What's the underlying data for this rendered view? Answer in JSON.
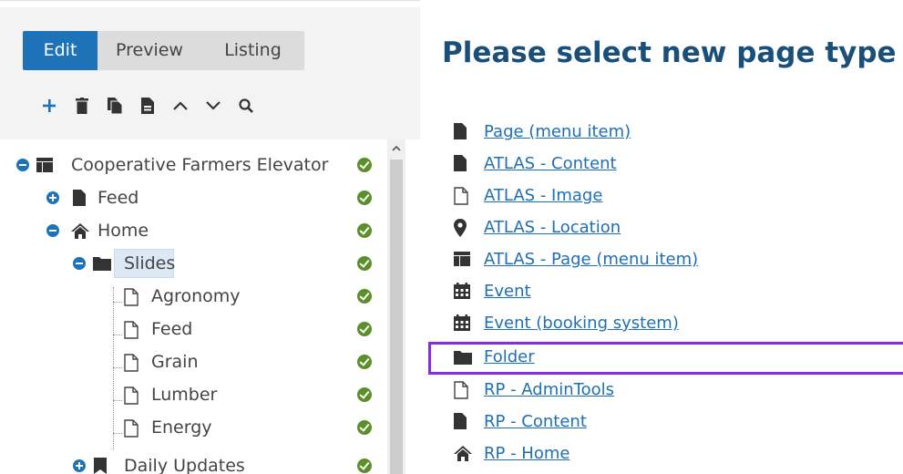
{
  "toolbar": {
    "tabs": [
      {
        "label": "Edit",
        "active": true
      },
      {
        "label": "Preview",
        "active": false
      },
      {
        "label": "Listing",
        "active": false
      }
    ],
    "tools": [
      "plus-icon",
      "trash-icon",
      "copy-icon",
      "paste-icon",
      "chevron-up-icon",
      "chevron-down-icon",
      "search-icon"
    ]
  },
  "tree": {
    "items": [
      {
        "label": "Cooperative Farmers Elevator",
        "icon": "table-icon",
        "toggle": "minus",
        "status": "ok"
      },
      {
        "label": "Feed",
        "icon": "file-icon",
        "toggle": "plus",
        "status": "ok"
      },
      {
        "label": "Home",
        "icon": "home-icon",
        "toggle": "minus",
        "status": "ok"
      },
      {
        "label": "Slides",
        "icon": "folder-icon",
        "toggle": "minus",
        "status": "ok",
        "selected": true
      },
      {
        "label": "Agronomy",
        "icon": "file-outline-icon",
        "status": "ok"
      },
      {
        "label": "Feed",
        "icon": "file-outline-icon",
        "status": "ok"
      },
      {
        "label": "Grain",
        "icon": "file-outline-icon",
        "status": "ok"
      },
      {
        "label": "Lumber",
        "icon": "file-outline-icon",
        "status": "ok"
      },
      {
        "label": "Energy",
        "icon": "file-outline-icon",
        "status": "ok"
      },
      {
        "label": "Daily Updates",
        "icon": "bookmark-icon",
        "toggle": "plus",
        "status": "ok"
      }
    ]
  },
  "main": {
    "title": "Please select new page type",
    "page_types": [
      {
        "label": "Page (menu item)",
        "icon": "file-icon"
      },
      {
        "label": "ATLAS - Content",
        "icon": "file-icon"
      },
      {
        "label": "ATLAS - Image",
        "icon": "file-outline-icon"
      },
      {
        "label": "ATLAS - Location",
        "icon": "map-marker-icon"
      },
      {
        "label": "ATLAS - Page (menu item)",
        "icon": "table-icon"
      },
      {
        "label": "Event",
        "icon": "calendar-icon"
      },
      {
        "label": "Event (booking system)",
        "icon": "calendar-icon"
      },
      {
        "label": "Folder",
        "icon": "folder-icon",
        "highlighted": true
      },
      {
        "label": "RP - AdminTools",
        "icon": "file-outline-icon"
      },
      {
        "label": "RP - Content",
        "icon": "file-icon"
      },
      {
        "label": "RP - Home",
        "icon": "home-icon"
      }
    ]
  },
  "colors": {
    "accent": "#1e73b8",
    "title": "#1a4f7a",
    "link": "#1e6fb5",
    "status_ok": "#5a8f29",
    "highlight": "#8a2be2"
  }
}
